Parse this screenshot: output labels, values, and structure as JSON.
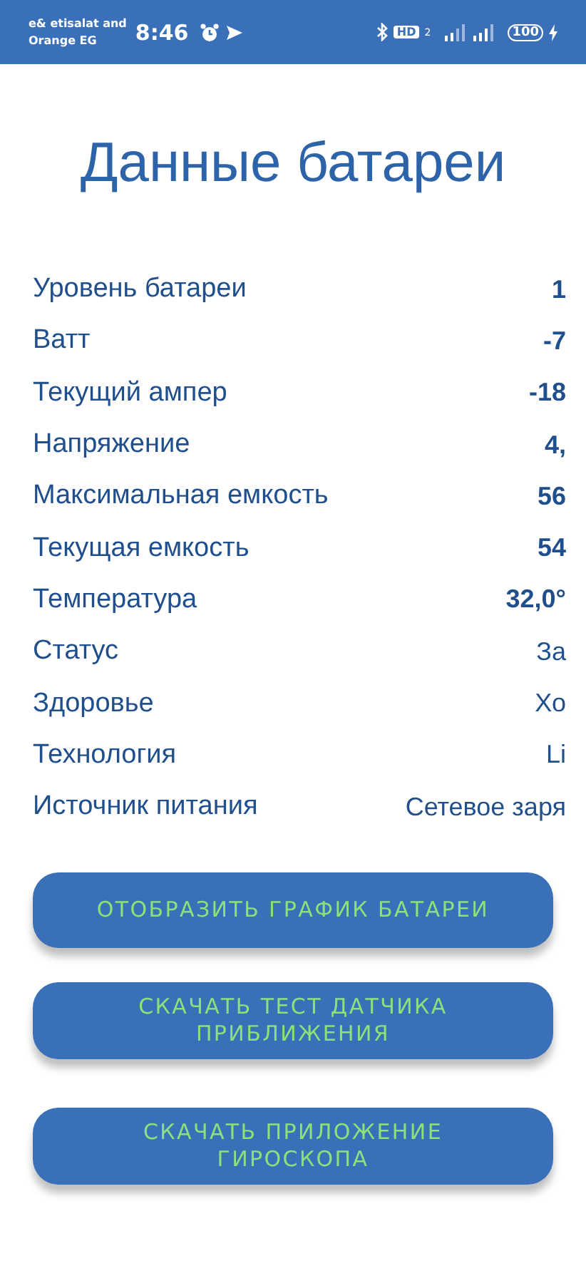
{
  "status_bar": {
    "carrier_lines": [
      "e& etisalat and",
      "Orange EG"
    ],
    "time": "8:46",
    "hd_label": "HD",
    "hd_sub": "2",
    "battery": "100"
  },
  "title": "Данные батареи",
  "rows": [
    {
      "label": "Уровень батареи",
      "value": "1",
      "kind": "number"
    },
    {
      "label": "Ватт",
      "value": "-7",
      "kind": "number"
    },
    {
      "label": "Текущий ампер",
      "value": "-18",
      "kind": "number"
    },
    {
      "label": "Напряжение",
      "value": "4,",
      "kind": "number"
    },
    {
      "label": "Максимальная емкость",
      "value": "56",
      "kind": "number"
    },
    {
      "label": "Текущая емкость",
      "value": "54",
      "kind": "number"
    },
    {
      "label": "Температура",
      "value": "32,0°",
      "kind": "number"
    },
    {
      "label": "Статус",
      "value": "За",
      "kind": "text"
    },
    {
      "label": "Здоровье",
      "value": "Хо",
      "kind": "text"
    },
    {
      "label": "Технология",
      "value": "Li",
      "kind": "text"
    },
    {
      "label": "Источник питания",
      "value": "Сетевое заря",
      "kind": "text"
    }
  ],
  "buttons": [
    "ОТОБРАЗИТЬ ГРАФИК БАТАРЕИ",
    "СКАЧАТЬ ТЕСТ ДАТЧИКА ПРИБЛИЖЕНИЯ",
    "СКАЧАТЬ ПРИЛОЖЕНИЕ ГИРОСКОПА"
  ]
}
